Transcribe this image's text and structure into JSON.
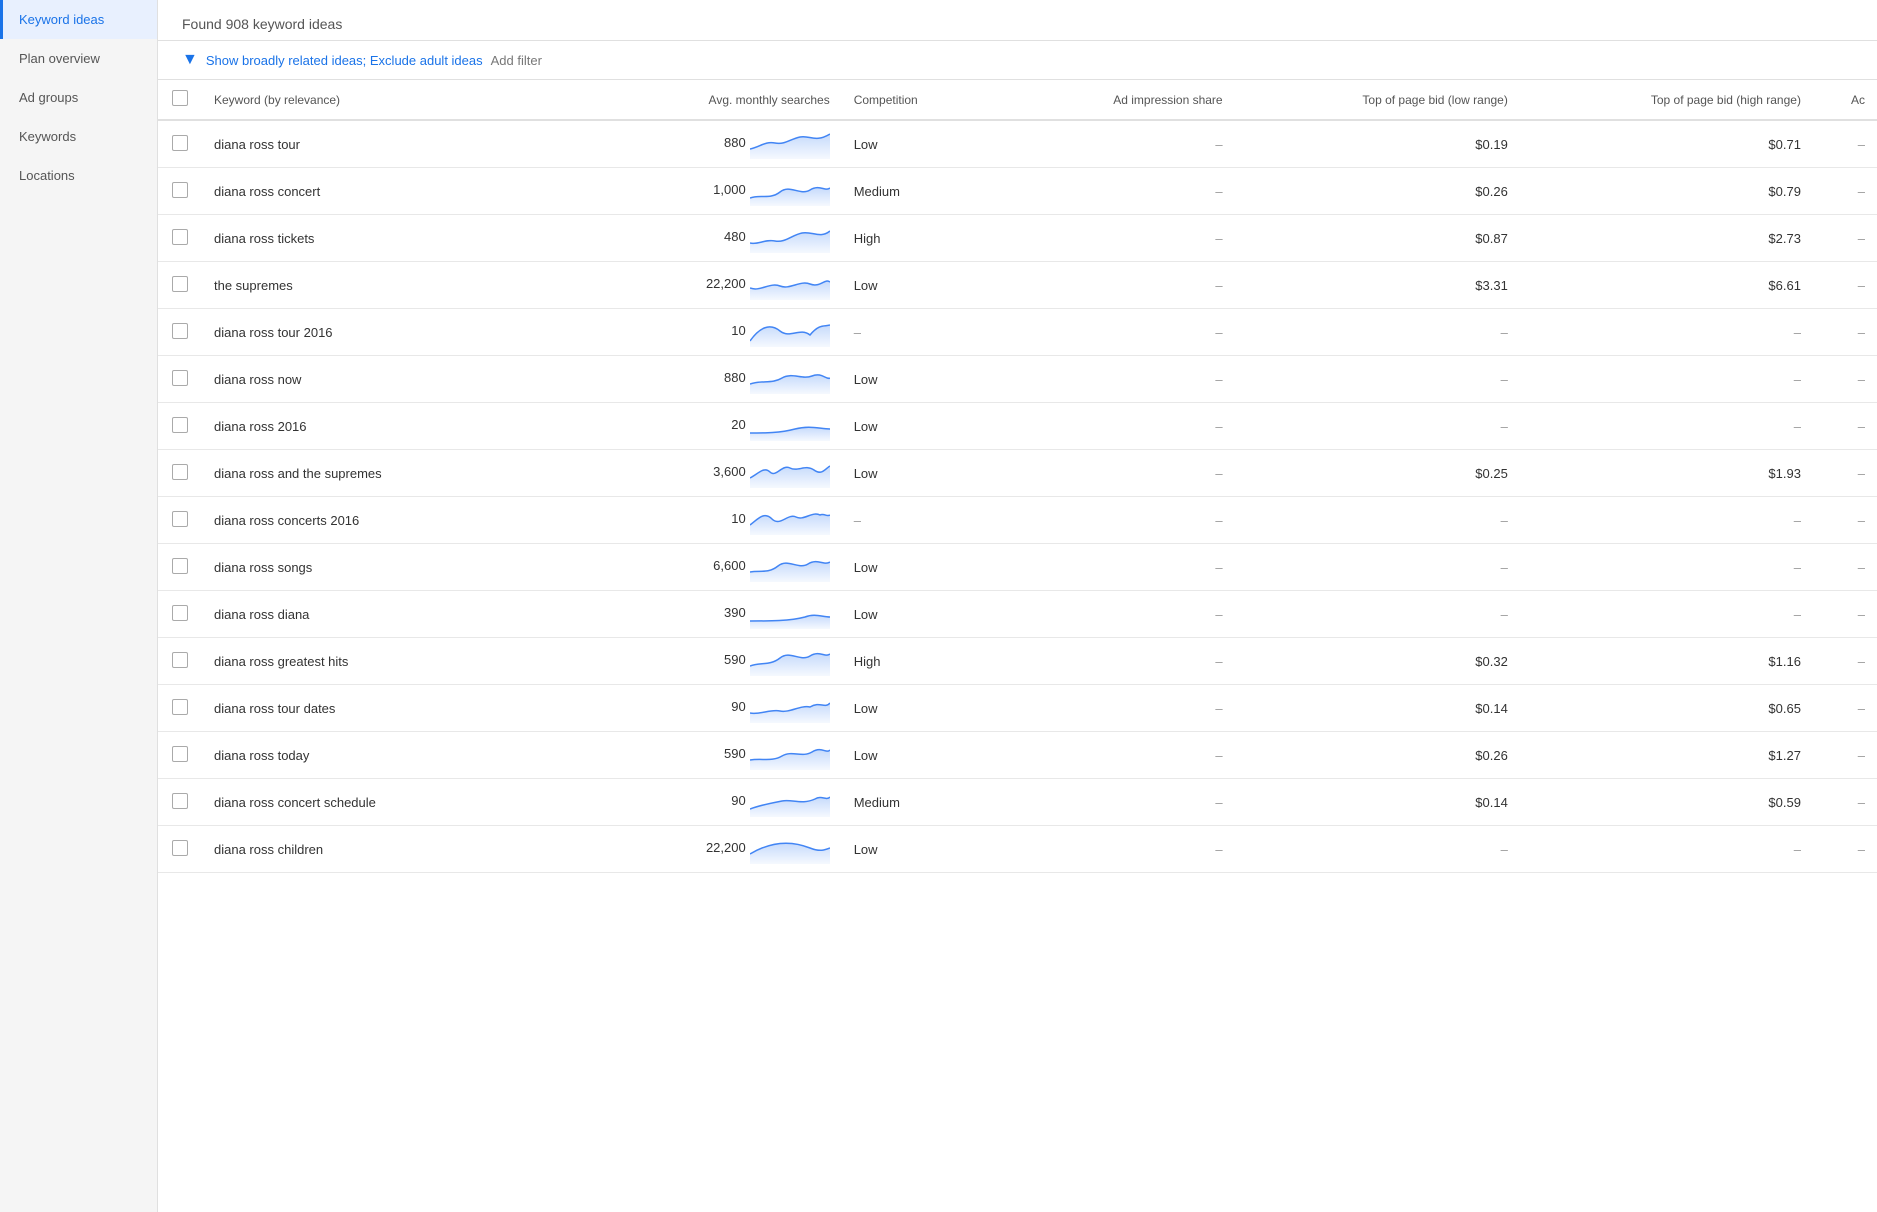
{
  "sidebar": {
    "items": [
      {
        "label": "Keyword ideas",
        "active": true
      },
      {
        "label": "Plan overview",
        "active": false
      },
      {
        "label": "Ad groups",
        "active": false
      },
      {
        "label": "Keywords",
        "active": false
      },
      {
        "label": "Locations",
        "active": false
      }
    ]
  },
  "header": {
    "found_text": "Found 908 keyword ideas"
  },
  "filter_bar": {
    "filter_icon": "▼",
    "links_text": "Show broadly related ideas; Exclude adult ideas",
    "add_filter": "Add filter"
  },
  "table": {
    "columns": [
      {
        "label": "",
        "key": "checkbox"
      },
      {
        "label": "Keyword (by relevance)",
        "key": "keyword"
      },
      {
        "label": "Avg. monthly searches",
        "key": "avg_searches"
      },
      {
        "label": "Competition",
        "key": "competition"
      },
      {
        "label": "Ad impression share",
        "key": "impression_share"
      },
      {
        "label": "Top of page bid (low range)",
        "key": "bid_low"
      },
      {
        "label": "Top of page bid (high range)",
        "key": "bid_high"
      },
      {
        "label": "Ac",
        "key": "ac"
      }
    ],
    "rows": [
      {
        "keyword": "diana ross tour",
        "avg_searches": "880",
        "competition": "Low",
        "impression_share": "–",
        "bid_low": "$0.19",
        "bid_high": "$0.71",
        "ac": "–",
        "spark": "wave1"
      },
      {
        "keyword": "diana ross concert",
        "avg_searches": "1,000",
        "competition": "Medium",
        "impression_share": "–",
        "bid_low": "$0.26",
        "bid_high": "$0.79",
        "ac": "–",
        "spark": "wave2"
      },
      {
        "keyword": "diana ross tickets",
        "avg_searches": "480",
        "competition": "High",
        "impression_share": "–",
        "bid_low": "$0.87",
        "bid_high": "$2.73",
        "ac": "–",
        "spark": "wave3"
      },
      {
        "keyword": "the supremes",
        "avg_searches": "22,200",
        "competition": "Low",
        "impression_share": "–",
        "bid_low": "$3.31",
        "bid_high": "$6.61",
        "ac": "–",
        "spark": "wave4"
      },
      {
        "keyword": "diana ross tour 2016",
        "avg_searches": "10",
        "competition": "–",
        "impression_share": "–",
        "bid_low": "–",
        "bid_high": "–",
        "ac": "–",
        "spark": "wave5"
      },
      {
        "keyword": "diana ross now",
        "avg_searches": "880",
        "competition": "Low",
        "impression_share": "–",
        "bid_low": "–",
        "bid_high": "–",
        "ac": "–",
        "spark": "wave6"
      },
      {
        "keyword": "diana ross 2016",
        "avg_searches": "20",
        "competition": "Low",
        "impression_share": "–",
        "bid_low": "–",
        "bid_high": "–",
        "ac": "–",
        "spark": "wave7"
      },
      {
        "keyword": "diana ross and the supremes",
        "avg_searches": "3,600",
        "competition": "Low",
        "impression_share": "–",
        "bid_low": "$0.25",
        "bid_high": "$1.93",
        "ac": "–",
        "spark": "wave8"
      },
      {
        "keyword": "diana ross concerts 2016",
        "avg_searches": "10",
        "competition": "–",
        "impression_share": "–",
        "bid_low": "–",
        "bid_high": "–",
        "ac": "–",
        "spark": "wave9"
      },
      {
        "keyword": "diana ross songs",
        "avg_searches": "6,600",
        "competition": "Low",
        "impression_share": "–",
        "bid_low": "–",
        "bid_high": "–",
        "ac": "–",
        "spark": "wave10"
      },
      {
        "keyword": "diana ross diana",
        "avg_searches": "390",
        "competition": "Low",
        "impression_share": "–",
        "bid_low": "–",
        "bid_high": "–",
        "ac": "–",
        "spark": "wave11"
      },
      {
        "keyword": "diana ross greatest hits",
        "avg_searches": "590",
        "competition": "High",
        "impression_share": "–",
        "bid_low": "$0.32",
        "bid_high": "$1.16",
        "ac": "–",
        "spark": "wave12"
      },
      {
        "keyword": "diana ross tour dates",
        "avg_searches": "90",
        "competition": "Low",
        "impression_share": "–",
        "bid_low": "$0.14",
        "bid_high": "$0.65",
        "ac": "–",
        "spark": "wave13"
      },
      {
        "keyword": "diana ross today",
        "avg_searches": "590",
        "competition": "Low",
        "impression_share": "–",
        "bid_low": "$0.26",
        "bid_high": "$1.27",
        "ac": "–",
        "spark": "wave14"
      },
      {
        "keyword": "diana ross concert schedule",
        "avg_searches": "90",
        "competition": "Medium",
        "impression_share": "–",
        "bid_low": "$0.14",
        "bid_high": "$0.59",
        "ac": "–",
        "spark": "wave15"
      },
      {
        "keyword": "diana ross children",
        "avg_searches": "22,200",
        "competition": "Low",
        "impression_share": "–",
        "bid_low": "–",
        "bid_high": "–",
        "ac": "–",
        "spark": "wave16"
      }
    ]
  }
}
